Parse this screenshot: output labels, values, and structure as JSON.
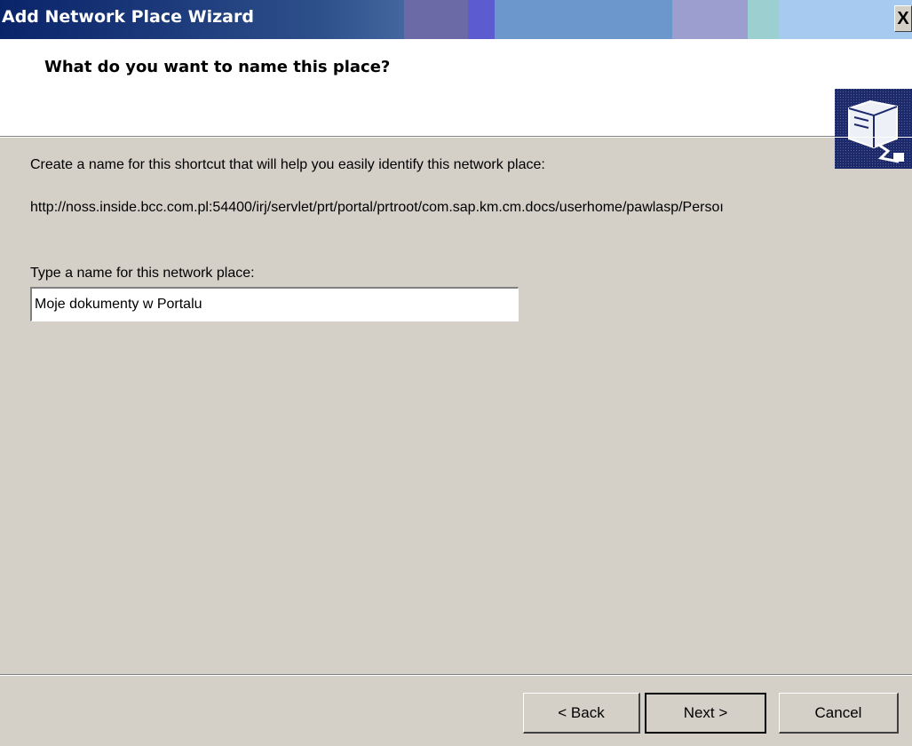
{
  "window": {
    "title": "Add Network Place Wizard",
    "close_label": "X"
  },
  "header": {
    "title": "What do you want to name this place?",
    "icon": "network-folder-icon"
  },
  "body": {
    "intro": "Create a name for this shortcut that will help you easily identify this network place:",
    "url": "http://noss.inside.bcc.com.pl:54400/irj/servlet/prt/portal/prtroot/com.sap.km.cm.docs/userhome/pawlasp/Persoı",
    "name_label": "Type a name for this network place:",
    "name_value": "Moje dokumenty w Portalu"
  },
  "buttons": {
    "back": "< Back",
    "next": "Next >",
    "cancel": "Cancel"
  },
  "colors": {
    "title_bar_start": "#0a246a",
    "dialog_face": "#d4d0c8",
    "header_bg": "#ffffff"
  }
}
